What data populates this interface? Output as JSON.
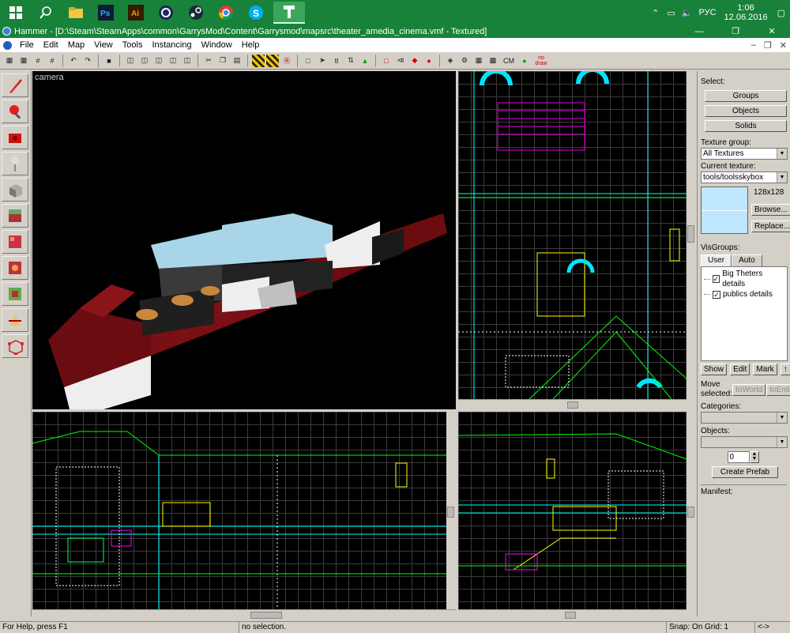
{
  "taskbar": {
    "apps": [
      "start",
      "search",
      "explorer",
      "photoshop",
      "illustrator",
      "cinema4d",
      "steam",
      "chrome",
      "skype",
      "hammer"
    ],
    "tray_lang": "РУС",
    "time": "1:06",
    "date": "12.06.2016",
    "accent": "#18823a"
  },
  "window": {
    "title": "Hammer - [D:\\Steam\\SteamApps\\common\\GarrysMod\\Content\\Garrysmod\\mapsrc\\theater_amedia_cinema.vmf - Textured]"
  },
  "menu": [
    "File",
    "Edit",
    "Map",
    "View",
    "Tools",
    "Instancing",
    "Window",
    "Help"
  ],
  "toolbar_text": {
    "cm": "CM",
    "nodraw": "no draw"
  },
  "views": {
    "camera_label": "camera"
  },
  "right_panel": {
    "select_label": "Select:",
    "groups": "Groups",
    "objects": "Objects",
    "solids": "Solids",
    "texture_group_label": "Texture group:",
    "texture_group_value": "All Textures",
    "current_texture_label": "Current texture:",
    "current_texture_value": "tools/toolsskybox",
    "texture_size": "128x128",
    "browse": "Browse...",
    "replace": "Replace...",
    "visgroups_label": "VisGroups:",
    "tab_user": "User",
    "tab_auto": "Auto",
    "visgroups": [
      {
        "name": "Big Theters details",
        "checked": true
      },
      {
        "name": "publics details",
        "checked": true
      }
    ],
    "show": "Show",
    "edit": "Edit",
    "mark": "Mark",
    "move_selected_label": "Move selected:",
    "to_world": "toWorld",
    "to_entity": "toEntity",
    "categories_label": "Categories:",
    "objects_label": "Objects:",
    "count_value": "0",
    "create_prefab": "Create Prefab",
    "manifest_label": "Manifest:"
  },
  "status": {
    "help": "For Help, press F1",
    "selection": "no selection.",
    "snap": "Snap: On Grid: 1",
    "arrows": "<->"
  }
}
